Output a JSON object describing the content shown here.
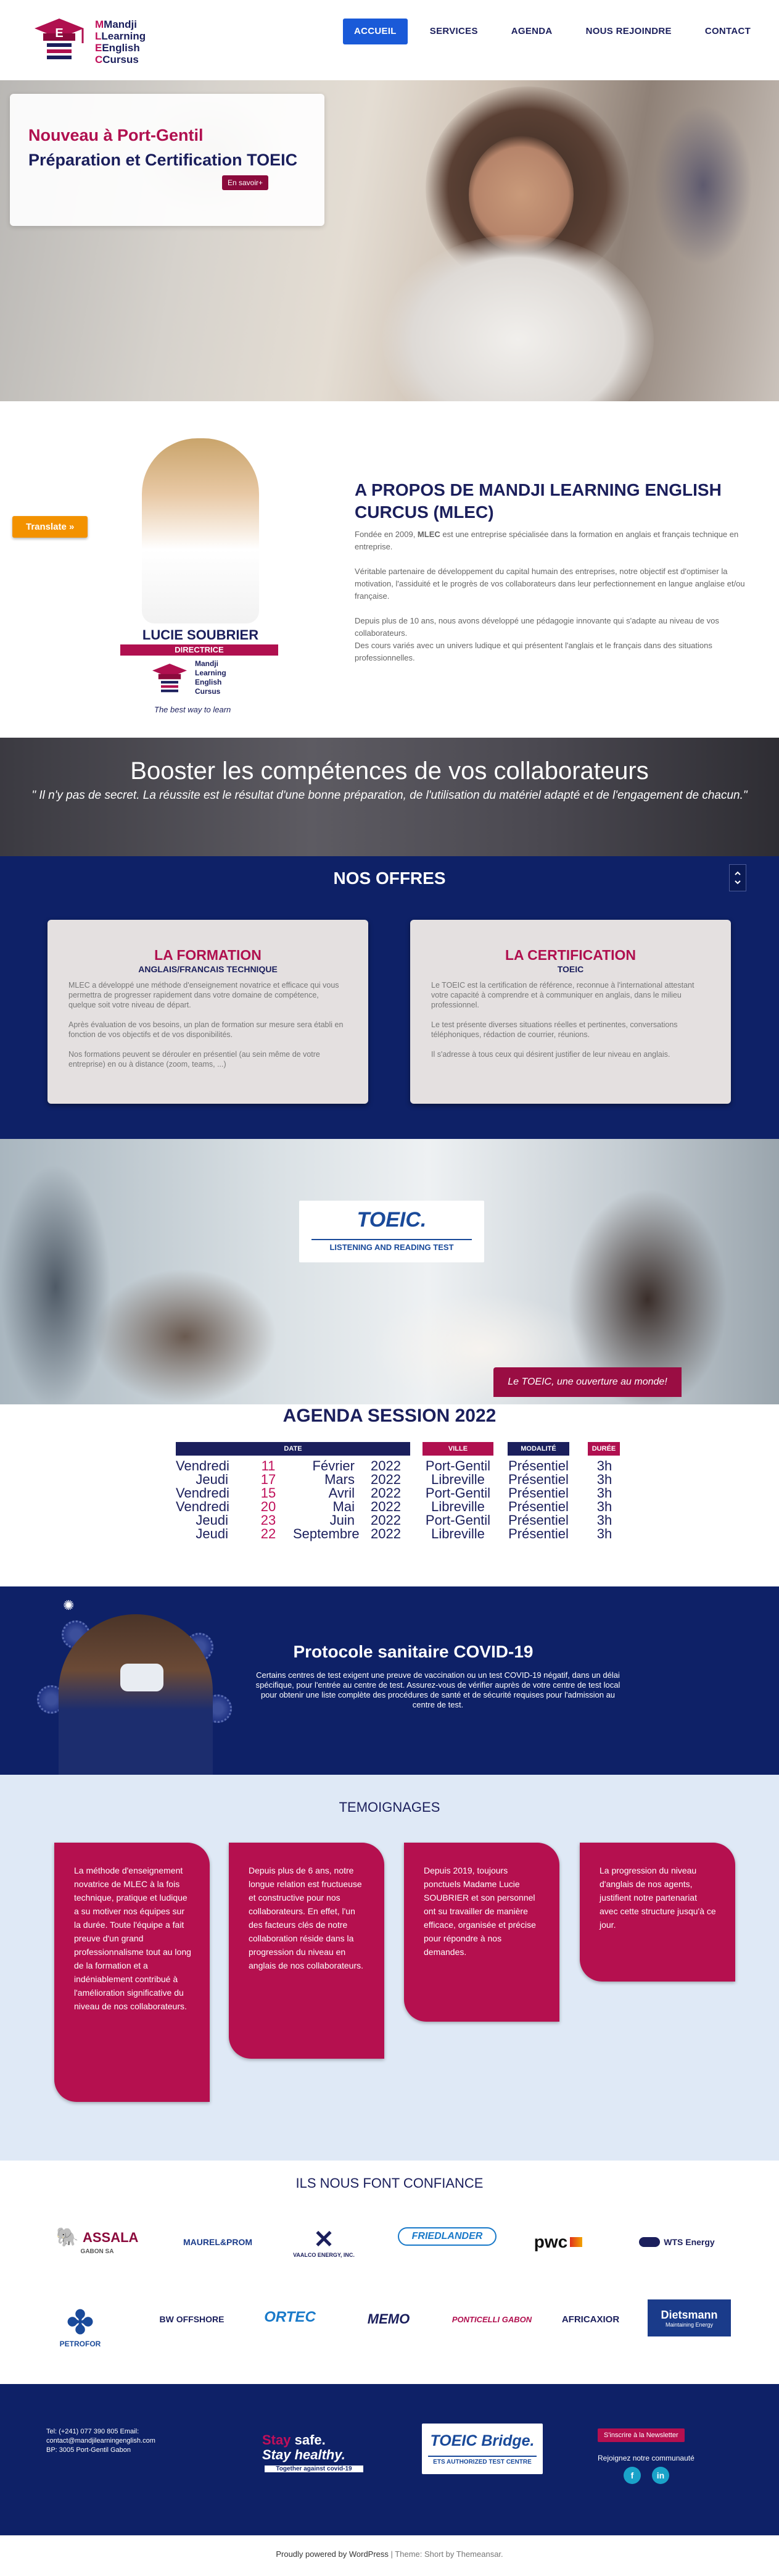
{
  "header": {
    "logo_lines": [
      "Mandji",
      "Learning",
      "English",
      "Cursus"
    ],
    "nav": [
      "ACCUEIL",
      "SERVICES",
      "AGENDA",
      "NOUS REJOINDRE",
      "CONTACT"
    ]
  },
  "hero": {
    "line1": "Nouveau à Port-Gentil",
    "line2": "Préparation et Certification TOEIC",
    "button": "En savoir+"
  },
  "translate_button": "Translate »",
  "about": {
    "director_name": "LUCIE SOUBRIER",
    "director_role": "DIRECTRICE",
    "mini_logo_lines": [
      "Mandji",
      "Learning",
      "English",
      "Cursus"
    ],
    "signature": "The best way to learn",
    "title": "A PROPOS DE MANDJI LEARNING ENGLISH CURCUS (MLEC)",
    "p1_before": "Fondée en 2009, ",
    "p1_bold": "MLEC",
    "p1_after": " est une entreprise spécialisée dans la formation en anglais et français technique en entreprise.",
    "p2": "Véritable partenaire de développement du capital humain des entreprises, notre objectif est d'optimiser la motivation, l'assiduité et le progrès de vos collaborateurs dans leur perfectionnement en langue anglaise et/ou française.",
    "p3": "Depuis plus de 10 ans, nous avons développé une pédagogie innovante qui s'adapte au niveau de vos collaborateurs.",
    "p4": "Des cours variés avec un univers ludique et qui présentent l'anglais et le français dans des situations professionnelles."
  },
  "booster": {
    "title": "Booster les compétences de vos collaborateurs",
    "quote": "\" Il n'y pas de secret. La réussite est le résultat d'une bonne préparation, de l'utilisation du matériel adapté et de l'engagement de chacun.\""
  },
  "offres": {
    "title": "NOS OFFRES",
    "formation": {
      "title": "LA FORMATION",
      "subtitle": "ANGLAIS/FRANCAIS TECHNIQUE",
      "p1": "MLEC a développé une méthode d'enseignement novatrice et efficace qui vous permettra de progresser rapidement dans votre domaine de compétence, quelque soit votre niveau de départ.",
      "p2": "Après évaluation de vos besoins, un plan de formation sur mesure sera établi en fonction de vos objectifs et de vos disponibilités.",
      "p3": "Nos formations peuvent se dérouler en présentiel (au sein même de votre entreprise) en ou à distance (zoom, teams, ...)"
    },
    "certification": {
      "title": "LA CERTIFICATION",
      "subtitle": "TOEIC",
      "p1": "Le TOEIC est la certification de référence, reconnue à l'international attestant votre capacité à comprendre et à communiquer en anglais, dans le milieu professionnel.",
      "p2": "Le test présente diverses situations réelles et pertinentes, conversations téléphoniques, rédaction de courrier, réunions.",
      "p3": "Il s'adresse à tous ceux qui désirent justifier de leur niveau en anglais."
    }
  },
  "toeic": {
    "logo": "TOEIC.",
    "subtitle": "LISTENING AND READING TEST",
    "tag": "Le TOEIC, une ouverture au monde!"
  },
  "agenda": {
    "title": "AGENDA SESSION 2022",
    "headers": [
      "DATE",
      "VILLE",
      "MODALITÉ",
      "DURÉE"
    ],
    "rows": [
      {
        "day": "Vendredi",
        "num": "11",
        "month": "Février",
        "year": "2022",
        "city": "Port-Gentil",
        "mode": "Présentiel",
        "dur": "3h"
      },
      {
        "day": "Jeudi",
        "num": "17",
        "month": "Mars",
        "year": "2022",
        "city": "Libreville",
        "mode": "Présentiel",
        "dur": "3h"
      },
      {
        "day": "Vendredi",
        "num": "15",
        "month": "Avril",
        "year": "2022",
        "city": "Port-Gentil",
        "mode": "Présentiel",
        "dur": "3h"
      },
      {
        "day": "Vendredi",
        "num": "20",
        "month": "Mai",
        "year": "2022",
        "city": "Libreville",
        "mode": "Présentiel",
        "dur": "3h"
      },
      {
        "day": "Jeudi",
        "num": "23",
        "month": "Juin",
        "year": "2022",
        "city": "Port-Gentil",
        "mode": "Présentiel",
        "dur": "3h"
      },
      {
        "day": "Jeudi",
        "num": "22",
        "month": "Septembre",
        "year": "2022",
        "city": "Libreville",
        "mode": "Présentiel",
        "dur": "3h"
      }
    ]
  },
  "covid": {
    "title": "Protocole sanitaire COVID-19",
    "text": "Certains centres de test exigent une preuve de vaccination ou un test COVID-19 négatif, dans un délai spécifique, pour l'entrée au centre de test. Assurez-vous de vérifier auprès de votre centre de test local pour obtenir une liste complète des procédures de santé et de sécurité requises pour l'admission au centre de test."
  },
  "temoignages": {
    "title": "TEMOIGNAGES",
    "items": [
      "La méthode d'enseignement novatrice de MLEC à la fois technique, pratique et ludique a su motiver nos équipes sur la durée. Toute l'équipe a fait preuve d'un grand professionnalisme tout au long de la formation et a indéniablement contribué à l'amélioration significative du niveau de nos collaborateurs.",
      "Depuis plus de 6 ans, notre longue relation est fructueuse et constructive pour nos collaborateurs. En effet, l'un des facteurs clés de notre collaboration réside dans la progression du niveau en anglais de nos collaborateurs.",
      "Depuis 2019, toujours ponctuels Madame Lucie SOUBRIER et son personnel ont su travailler de manière efficace, organisée et précise pour répondre à nos demandes.",
      "La progression du niveau d'anglais de nos agents, justifient notre partenariat avec cette structure jusqu'à ce jour."
    ]
  },
  "confiance": {
    "title": "ILS NOUS FONT CONFIANCE",
    "logos_row1": [
      "ASSALA",
      "GABON SA",
      "MAUREL&PROM",
      "VAALCO ENERGY, INC.",
      "FRIEDLANDER",
      "pwc",
      "WTS Energy"
    ],
    "logos_row2": [
      "PETROFOR",
      "BW OFFSHORE",
      "ORTEC",
      "MEMO",
      "PONTICELLI GABON",
      "AFRICAXIOR",
      "Dietsmann",
      "Maintaining Energy"
    ]
  },
  "footer": {
    "contact": "Tel: (+241) 077 390 805 Email: contact@mandjilearningenglish.com BP: 3005 Port-Gentil Gabon",
    "ssh_l1a": "Stay",
    "ssh_l1b": " safe.",
    "ssh_l2": "Stay healthy.",
    "ssh_l3": "Together against covid-19",
    "bridge_title": "TOEIC Bridge.",
    "bridge_sub": "ETS AUTHORIZED TEST CENTRE",
    "newsletter": "S'inscrire à la Newsletter",
    "rejoignez": "Rejoignez notre communauté",
    "social": [
      "f",
      "in"
    ]
  },
  "bottom": {
    "powered": "Proudly powered by WordPress",
    "sep": " | ",
    "theme": "Theme: Short by Themeansar."
  }
}
